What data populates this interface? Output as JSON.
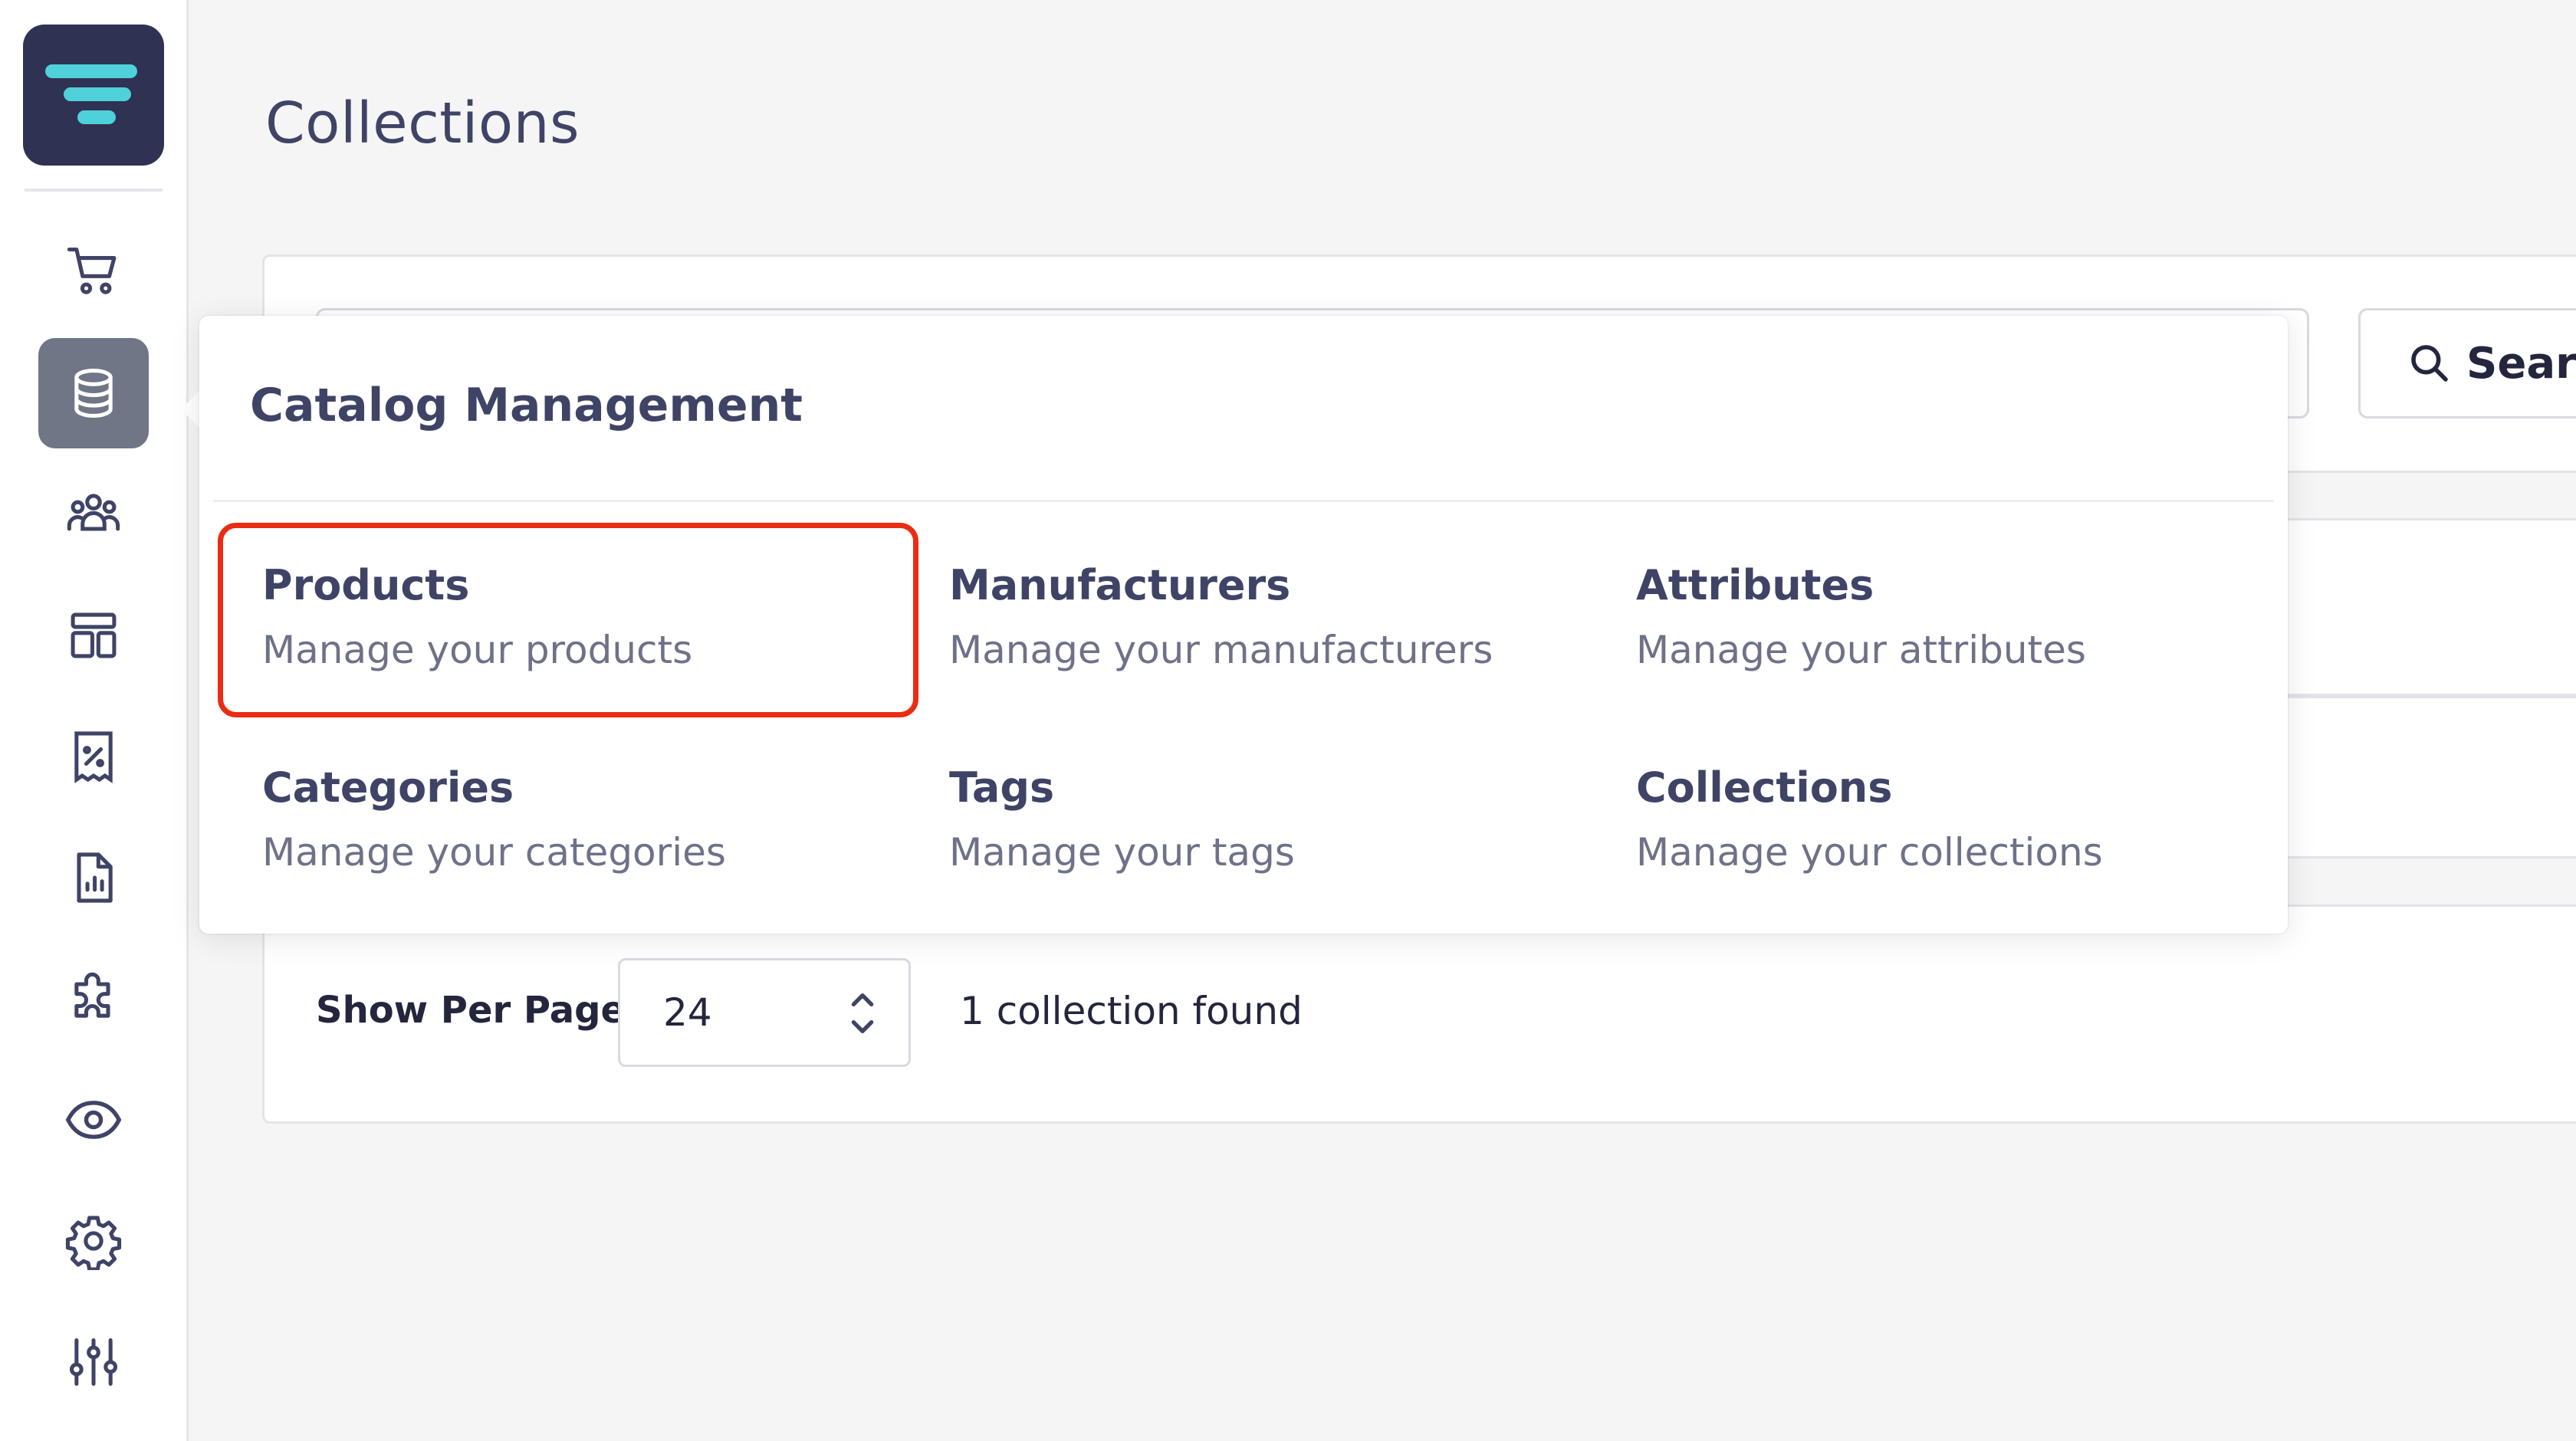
{
  "page": {
    "title": "Collections"
  },
  "sidebar": {
    "items": [
      {
        "icon": "cart-icon",
        "label": "Orders"
      },
      {
        "icon": "database-icon",
        "label": "Catalog",
        "active": true
      },
      {
        "icon": "users-icon",
        "label": "Customers"
      },
      {
        "icon": "layout-icon",
        "label": "Content"
      },
      {
        "icon": "discount-icon",
        "label": "Promotions"
      },
      {
        "icon": "report-icon",
        "label": "Reports"
      },
      {
        "icon": "puzzle-icon",
        "label": "Extensions"
      },
      {
        "icon": "eye-icon",
        "label": "Preview"
      },
      {
        "icon": "gear-icon",
        "label": "Settings"
      },
      {
        "icon": "sliders-icon",
        "label": "Configuration"
      }
    ]
  },
  "search": {
    "button_label": "Search",
    "placeholder": ""
  },
  "popover": {
    "title": "Catalog Management",
    "items": [
      {
        "title": "Products",
        "desc": "Manage your products"
      },
      {
        "title": "Manufacturers",
        "desc": "Manage your manufacturers"
      },
      {
        "title": "Attributes",
        "desc": "Manage your attributes"
      },
      {
        "title": "Categories",
        "desc": "Manage your categories"
      },
      {
        "title": "Tags",
        "desc": "Manage your tags"
      },
      {
        "title": "Collections",
        "desc": "Manage your collections"
      }
    ]
  },
  "pagination": {
    "per_page_label": "Show Per Page",
    "per_page_value": "24",
    "found_text": "1 collection found"
  },
  "colors": {
    "brand": "#2f3252",
    "accent": "#4fd1d9",
    "highlight": "#ea2c14"
  }
}
